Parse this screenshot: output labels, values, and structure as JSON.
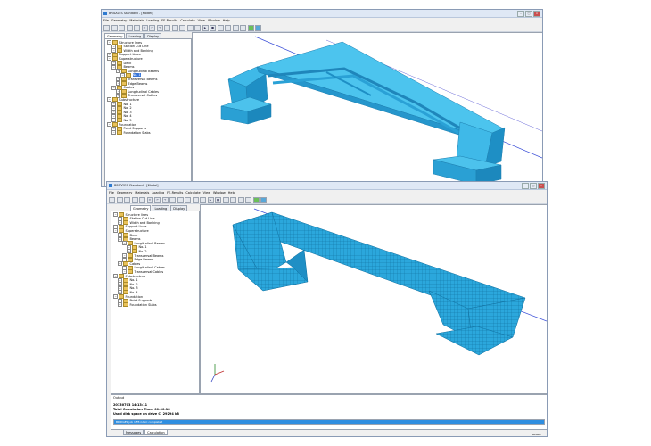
{
  "app": {
    "title": "BRIDGES Standard - [Model]",
    "menu": [
      "File",
      "Geometry",
      "Materials",
      "Loading",
      "FE-Results",
      "Calculate",
      "View",
      "Window",
      "Help"
    ],
    "panel_tabs": [
      "Geometry",
      "Loading",
      "Display"
    ],
    "accent": "#2fa7de"
  },
  "tree_top": {
    "items": [
      {
        "label": "Structure lines"
      },
      {
        "label": "Station Cut Line"
      },
      {
        "label": "Width and Banking"
      },
      {
        "label": "Support Lines"
      },
      {
        "label": "Superstructure"
      },
      {
        "label": "Deck"
      },
      {
        "label": "Beams"
      },
      {
        "label": "Longitudinal Beams"
      },
      {
        "label": "No. 1"
      },
      {
        "label": "Transversal Beams"
      },
      {
        "label": "Edge Beams"
      },
      {
        "label": "Cables"
      },
      {
        "label": "Longitudinal Cables"
      },
      {
        "label": "Transversal Cables"
      },
      {
        "label": "Substructure"
      },
      {
        "label": "No. 1"
      },
      {
        "label": "No. 2"
      },
      {
        "label": "No. 3"
      },
      {
        "label": "No. 4"
      },
      {
        "label": "No. 5"
      },
      {
        "label": "Foundation"
      },
      {
        "label": "Point Supports"
      },
      {
        "label": "Foundation Slabs"
      }
    ]
  },
  "tree_bottom": {
    "items": [
      {
        "label": "Structure lines"
      },
      {
        "label": "Station Cut Line"
      },
      {
        "label": "Width and Banking"
      },
      {
        "label": "Support Lines"
      },
      {
        "label": "Superstructure"
      },
      {
        "label": "Deck"
      },
      {
        "label": "Beams"
      },
      {
        "label": "Longitudinal Beams"
      },
      {
        "label": "No. 1"
      },
      {
        "label": "No. 2"
      },
      {
        "label": "Transversal Beams"
      },
      {
        "label": "Edge Beams"
      },
      {
        "label": "Cables"
      },
      {
        "label": "Longitudinal Cables"
      },
      {
        "label": "Transversal Cables"
      },
      {
        "label": "Substructure"
      },
      {
        "label": "No. 1"
      },
      {
        "label": "No. 2"
      },
      {
        "label": "No. 3"
      },
      {
        "label": "No. 4"
      },
      {
        "label": "Foundation"
      },
      {
        "label": "Point Supports"
      },
      {
        "label": "Foundation Slabs"
      }
    ]
  },
  "output": {
    "title": "Output",
    "lines": [
      "20130703 14:13:11",
      "Total Calculation Time: 00:00:18",
      "Used disk space on drive C: 29294 kB"
    ],
    "progress_text": "BRIDGES job 1 FE-CALC completed",
    "progress": 1.0,
    "tabs": [
      "Messages",
      "Calculation"
    ],
    "status": "READY"
  }
}
